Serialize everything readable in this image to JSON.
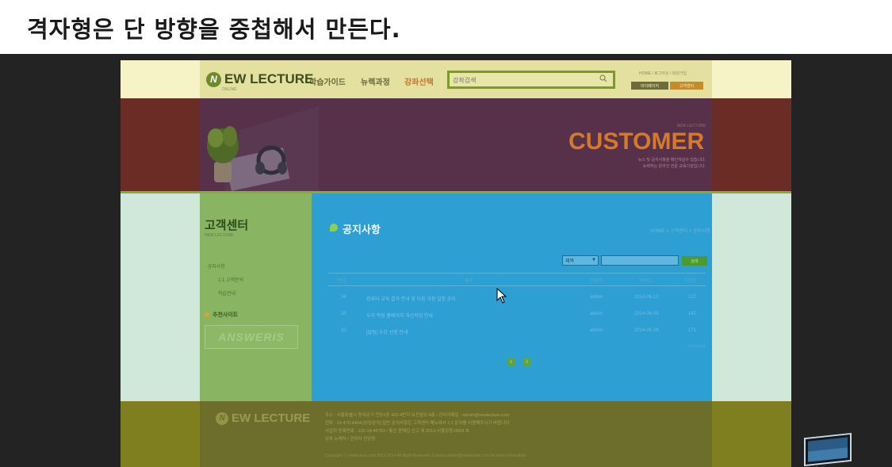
{
  "slide": {
    "title": "격자형은 단 방향을 중첩해서 만든다."
  },
  "site": {
    "logo": {
      "badge": "N",
      "text": "EW LECTURE",
      "sub": "ONLINE"
    },
    "nav": [
      {
        "label": "학습가이드"
      },
      {
        "label": "뉴렉과정"
      },
      {
        "label": "강좌선택"
      }
    ],
    "search": {
      "placeholder": "강좌검색"
    },
    "util": {
      "links": "HOME / 로그아웃 / 회원가입",
      "mypage": "마이페이지",
      "center": "고객센터"
    },
    "banner": {
      "brand": "NEW LECTURE",
      "headline": "CUSTOMER",
      "desc1": "뉴스 및 공지사항을 확인하실수 있습니다.",
      "desc2": "뉴렉처는 온라인 전문 교육기관입니다."
    },
    "sidebar": {
      "title": "고객센터",
      "sub": "NEW LECTURE",
      "items": [
        "공지사항",
        "1:1 고객문의",
        "학습안내"
      ],
      "recommend": "추천사이트",
      "partner": "ANSWERIS"
    },
    "content": {
      "title": "공지사항",
      "breadcrumb": "HOME > 고객센터 > 공지사항",
      "filter": {
        "selected": "제목",
        "button": "검색"
      },
      "headers": [
        "번호",
        "제목",
        "작성자",
        "작성일",
        "조회수"
      ],
      "rows": [
        {
          "no": "34",
          "title": "컴퓨터 교육 결과 안내 및 다음 과정 일정 공지",
          "author": "admin",
          "date": "2014-06-12",
          "hits": "127"
        },
        {
          "no": "33",
          "title": "우리 학원 홈페이지 개선작업 안내",
          "author": "admin",
          "date": "2014-06-05",
          "hits": "142"
        },
        {
          "no": "32",
          "title": "[알림] 수강 신청 안내",
          "author": "admin",
          "date": "2014-05-28",
          "hits": "171"
        }
      ],
      "total": "1/5 pages",
      "pager": [
        "1",
        "2"
      ]
    },
    "footer": {
      "logo_badge": "N",
      "logo_text": "EW LECTURE",
      "line1": "주소 : 서울특별시 동대문구 전농1동 423-4번지 유진빌딩 4층 /  관리자메일 : admin@newlecture.com",
      "line2": "전화 : 02-470-4404 [상담문의] 일반 문의사항은 고객센터 메뉴에서 1:1 문의를 이용해주시기 바랍니다",
      "line3": "사업자 등록번호 : 132-18-46763 / 통신 판매업 신고 제 2013-서울강동-0969 호",
      "line4": "상호 뉴렉처 / 관리자 전상영",
      "copyright": "Copyright ⓒ newlecture.com 2012-2014 All Right Reserved. Contact admin@newlecture.com for more information"
    }
  },
  "colors": {
    "header_band": "#f6f3c6",
    "banner_band": "#6b2c26",
    "side_columns": "#cfe8da",
    "sidebar_overlay": "#89b563",
    "content_overlay": "#2e9fd3",
    "footer_band": "#7f7f1f",
    "accent_orange": "#d47a2a"
  }
}
